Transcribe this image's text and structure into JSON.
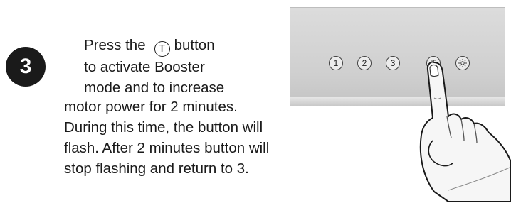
{
  "step": {
    "number": "3"
  },
  "instructions": {
    "line1_pre": "Press the",
    "inline_button": "T",
    "line1_post": "button",
    "line2": "to activate Booster",
    "line3": "mode and to increase",
    "line4": "motor power for 2 minutes.",
    "line5": "During this time, the button will",
    "line6": "flash. After 2 minutes button will",
    "line7": "stop flashing and return to 3."
  },
  "panel": {
    "buttons": [
      {
        "label": "1"
      },
      {
        "label": "2"
      },
      {
        "label": "3"
      },
      {
        "label": "T"
      },
      {
        "icon": "light-icon"
      }
    ]
  }
}
